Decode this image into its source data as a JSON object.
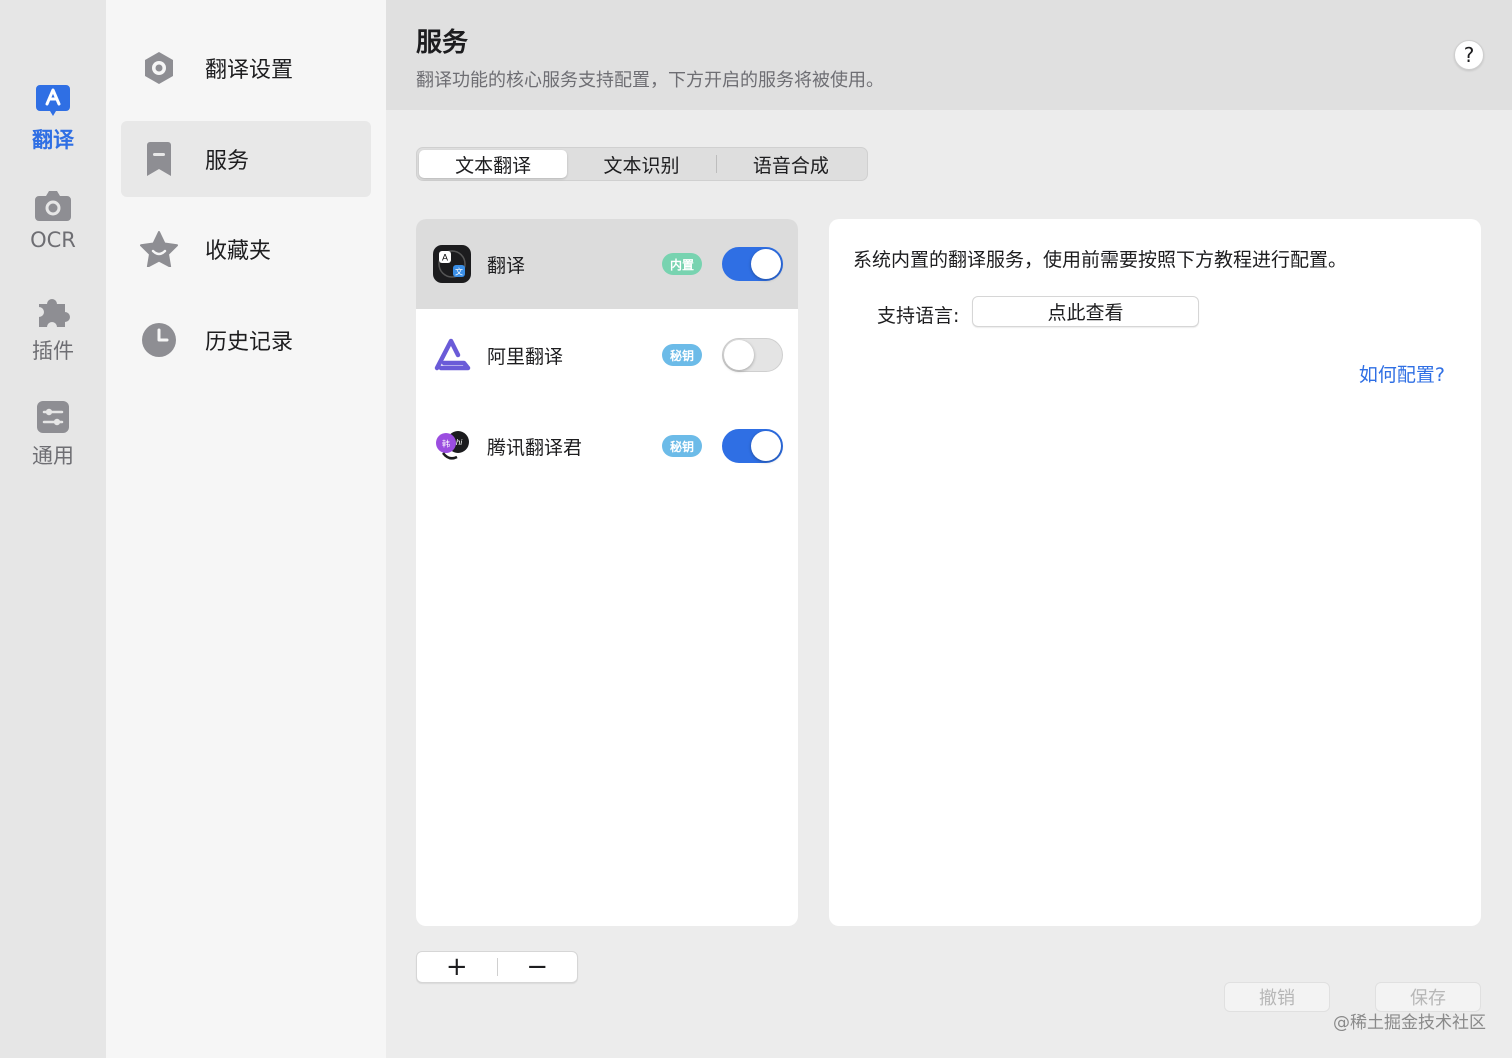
{
  "rail": {
    "items": [
      {
        "label": "翻译",
        "active": true
      },
      {
        "label": "OCR",
        "active": false
      },
      {
        "label": "插件",
        "active": false
      },
      {
        "label": "通用",
        "active": false
      }
    ]
  },
  "categories": {
    "items": [
      {
        "label": "翻译设置"
      },
      {
        "label": "服务"
      },
      {
        "label": "收藏夹"
      },
      {
        "label": "历史记录"
      }
    ]
  },
  "header": {
    "title": "服务",
    "subtitle": "翻译功能的核心服务支持配置，下方开启的服务将被使用。",
    "help": "?"
  },
  "tabs": [
    {
      "label": "文本翻译"
    },
    {
      "label": "文本识别"
    },
    {
      "label": "语音合成"
    }
  ],
  "services": [
    {
      "name": "翻译",
      "badge": "内置",
      "enabled": true
    },
    {
      "name": "阿里翻译",
      "badge": "秘钥",
      "enabled": false
    },
    {
      "name": "腾讯翻译君",
      "badge": "秘钥",
      "enabled": true
    }
  ],
  "list_controls": {
    "add": "+",
    "remove": "−"
  },
  "detail": {
    "description": "系统内置的翻译服务，使用前需要按照下方教程进行配置。",
    "languages_label": "支持语言:",
    "languages_button": "点此查看",
    "howto_link": "如何配置?"
  },
  "footer": {
    "cancel": "撤销",
    "save": "保存"
  },
  "watermark": "@稀土掘金技术社区",
  "colors": {
    "accent": "#2f6fe4",
    "badge_builtin": "#78d3b0",
    "badge_key": "#6cbbe8"
  }
}
